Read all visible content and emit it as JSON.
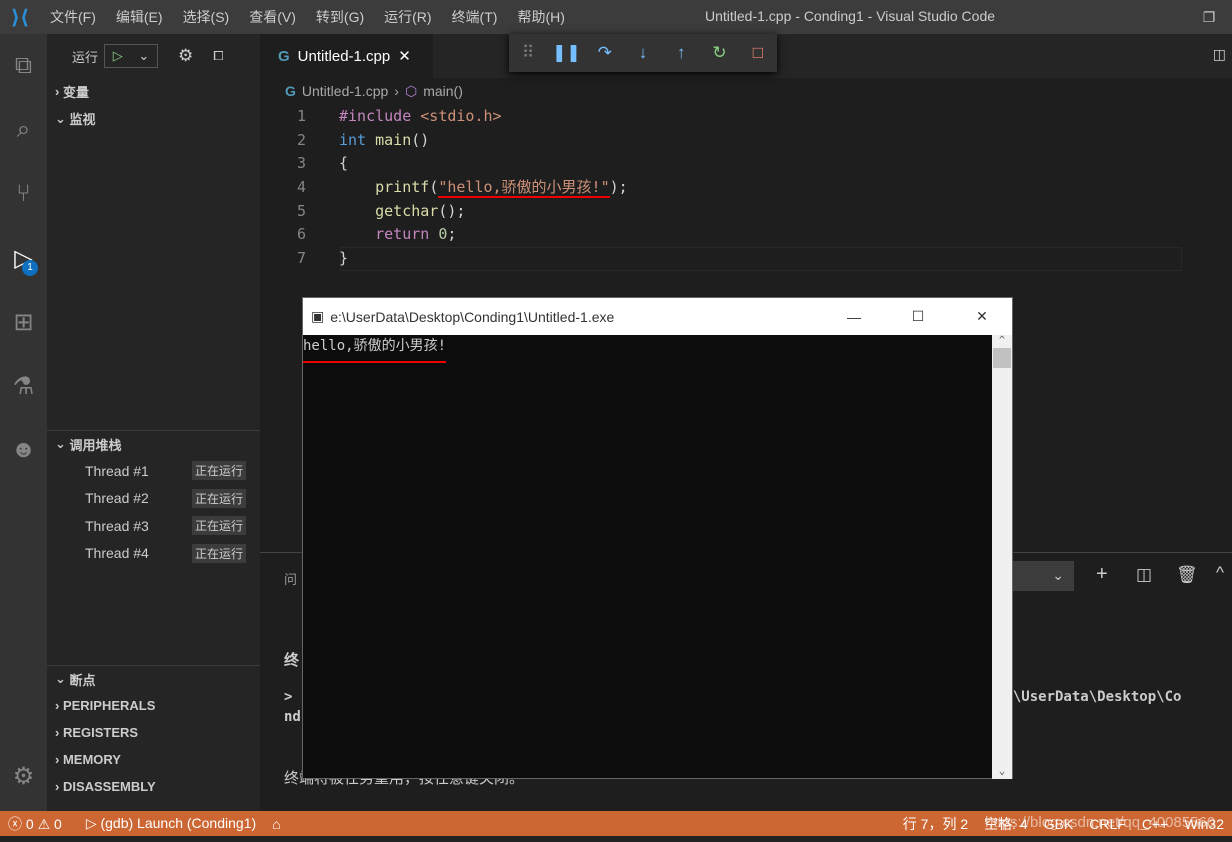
{
  "titlebar": {
    "menus": [
      "文件(F)",
      "编辑(E)",
      "选择(S)",
      "查看(V)",
      "转到(G)",
      "运行(R)",
      "终端(T)",
      "帮助(H)"
    ],
    "title": "Untitled-1.cpp - Conding1 - Visual Studio Code"
  },
  "activity": {
    "debug_badge": "1"
  },
  "sidebar": {
    "run_label": "运行",
    "sections": {
      "variables": "变量",
      "watch": "监视",
      "callstack": "调用堆栈",
      "breakpoints": "断点"
    },
    "threads": [
      {
        "name": "Thread #1",
        "status": "正在运行"
      },
      {
        "name": "Thread #2",
        "status": "正在运行"
      },
      {
        "name": "Thread #3",
        "status": "正在运行"
      },
      {
        "name": "Thread #4",
        "status": "正在运行"
      }
    ],
    "extra": [
      "PERIPHERALS",
      "REGISTERS",
      "MEMORY",
      "DISASSEMBLY"
    ]
  },
  "editor": {
    "tab": "Untitled-1.cpp",
    "breadcrumb": {
      "file": "Untitled-1.cpp",
      "symbol": "main()"
    }
  },
  "console": {
    "title": "e:\\UserData\\Desktop\\Conding1\\Untitled-1.exe",
    "output": "hello,骄傲的小男孩!"
  },
  "panel": {
    "tab_partial": "问",
    "line1": "终",
    "prompt": ">",
    "path_partial": "e:\\UserData\\Desktop\\Co",
    "line2": "nd",
    "line3": "终端将被任务重用，按任意键关闭。"
  },
  "status": {
    "errors": "0",
    "warnings": "0",
    "launch": "(gdb) Launch (Conding1)",
    "position": "行 7，列 2",
    "spaces": "空格: 4",
    "encoding": "GBK",
    "eol": "CRLF",
    "lang": "C++",
    "platform": "Win32",
    "watermark": "https://blog.csdn.net/qq_40085560"
  },
  "colors": {
    "status_bg": "#cc6633",
    "accent": "#0e70c0"
  }
}
